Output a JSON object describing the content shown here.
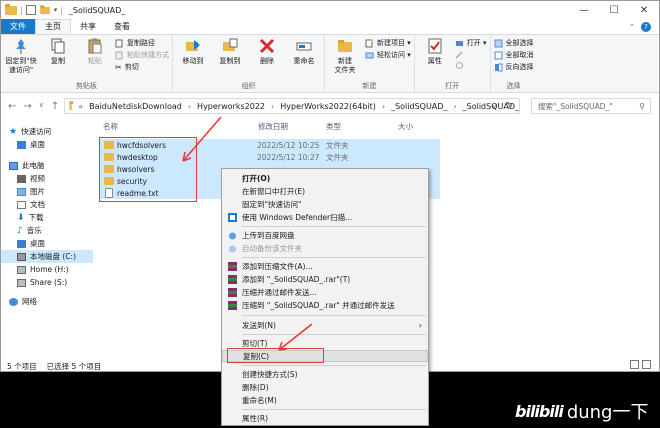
{
  "window": {
    "title": "_SolidSQUAD_"
  },
  "tabs": {
    "file": "文件",
    "home": "主页",
    "share": "共享",
    "view": "查看"
  },
  "ribbon": {
    "pin_quick": "固定到\"快\n速访问\"",
    "copy": "复制",
    "paste": "粘贴",
    "copy_path": "复制路径",
    "paste_shortcut": "粘贴快捷方式",
    "cut": "剪切",
    "move_to": "移动到",
    "copy_to": "复制到",
    "delete": "删除",
    "rename": "重命名",
    "new_folder": "新建\n文件夹",
    "new_item": "新建项目 ▾",
    "easy_access": "轻松访问 ▾",
    "properties": "属性",
    "open": "打开 ▾",
    "select_all": "全部选择",
    "select_none": "全部取消",
    "invert": "反向选择",
    "group_clipboard": "剪贴板",
    "group_organize": "组织",
    "group_new": "新建",
    "group_open": "打开",
    "group_select": "选择"
  },
  "address": {
    "crumbs": [
      "BaiduNetdiskDownload",
      "Hyperworks2022",
      "HyperWorks2022(64bit)",
      "_SolidSQUAD_",
      "_SolidSQUAD_"
    ],
    "search_placeholder": "搜索\"_SolidSQUAD_\""
  },
  "sidebar": {
    "items": [
      "快速访问",
      "桌面",
      "此电脑",
      "视频",
      "图片",
      "文档",
      "下载",
      "音乐",
      "桌面",
      "本地磁盘 (C:)",
      "Home (H:)",
      "Share (S:)",
      "网络"
    ]
  },
  "columns": {
    "name": "名称",
    "date": "修改日期",
    "type": "类型",
    "size": "大小"
  },
  "files": [
    {
      "name": "hwcfdsolvers",
      "date": "2022/5/12 10:25",
      "type": "文件夹"
    },
    {
      "name": "hwdesktop",
      "date": "2022/5/12 10:27",
      "type": "文件夹"
    },
    {
      "name": "hwsolvers",
      "date": "",
      "type": ""
    },
    {
      "name": "security",
      "date": "",
      "type": ""
    },
    {
      "name": "readme.txt",
      "date": "",
      "type": ""
    }
  ],
  "status": {
    "count": "5 个项目",
    "selected": "已选择 5 个项目"
  },
  "menu": {
    "open": "打开(O)",
    "open_new": "在新窗口中打开(E)",
    "pin_quick": "固定到\"快速访问\"",
    "defender": "使用 Windows Defender扫描...",
    "upload_baidu": "上传到百度网盘",
    "auto_backup": "自动备份该文件夹",
    "add_archive": "添加到压缩文件(A)...",
    "add_rar": "添加到 \"_SolidSQUAD_.rar\"(T)",
    "compress_email": "压缩并通过邮件发送...",
    "compress_rar_email": "压缩到 \"_SolidSQUAD_.rar\" 并通过邮件发送",
    "send_to": "发送到(N)",
    "cut": "剪切(T)",
    "copy": "复制(C)",
    "create_shortcut": "创建快捷方式(S)",
    "delete": "删除(D)",
    "rename": "重命名(M)",
    "properties": "属性(R)"
  },
  "watermark": {
    "logo": "bilibili",
    "user": "dung一下"
  },
  "colors": {
    "accent": "#1979ca",
    "selection": "#cce8ff",
    "annotation": "#e03c3c",
    "folder": "#e8b84a"
  }
}
